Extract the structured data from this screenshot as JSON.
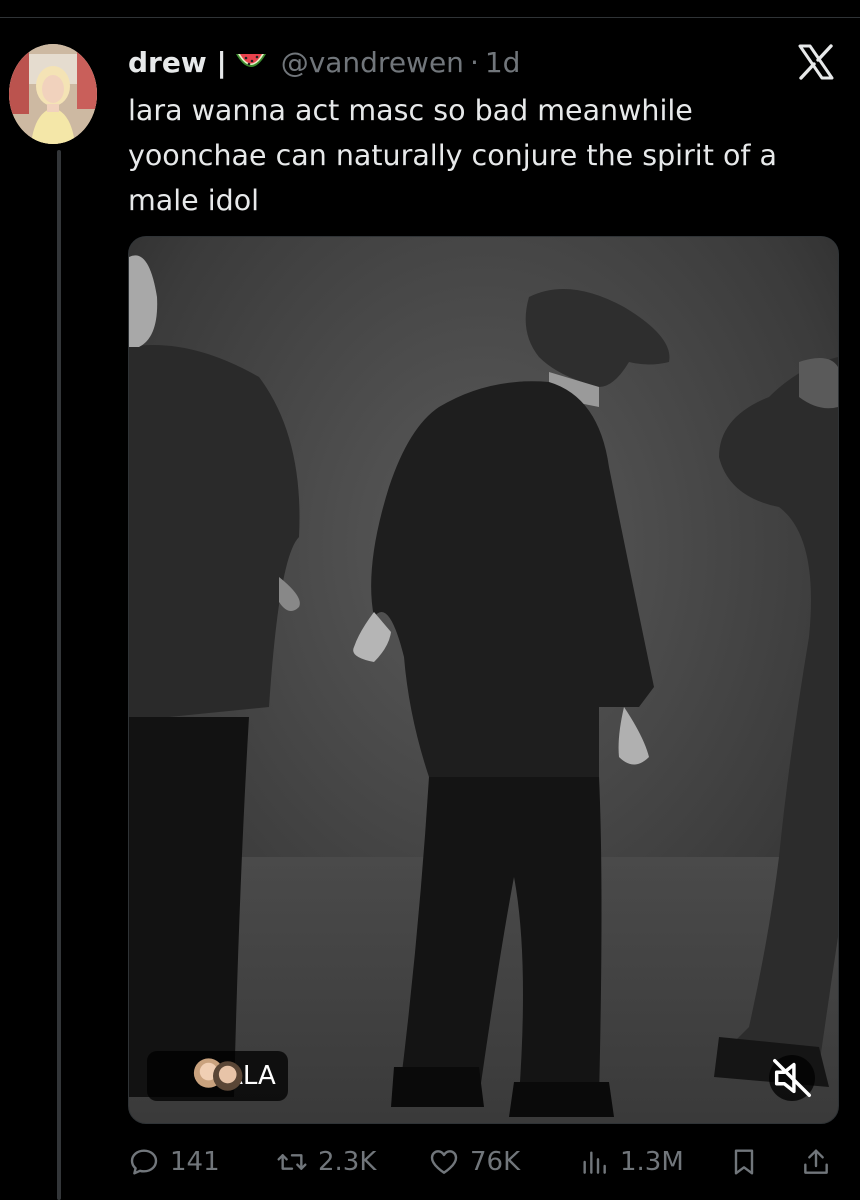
{
  "tweet": {
    "author_name": "drew |",
    "handle": "@vandrewen",
    "separator": "·",
    "time": "1d",
    "text": "lara wanna act masc so bad meanwhile yoonchae can naturally conjure the spirit of a male idol",
    "media": {
      "badge_label": "GALA",
      "type": "video"
    }
  },
  "actions": {
    "replies": "141",
    "reposts": "2.3K",
    "likes": "76K",
    "views": "1.3M"
  },
  "colors": {
    "background": "#000000",
    "text": "#e7e9ea",
    "secondary": "#71767b",
    "divider": "#2f3336"
  },
  "icons": [
    "avatar",
    "watermelon-emoji",
    "x-logo-icon",
    "reply-icon",
    "repost-icon",
    "like-icon",
    "views-icon",
    "bookmark-icon",
    "share-icon",
    "mute-icon"
  ]
}
